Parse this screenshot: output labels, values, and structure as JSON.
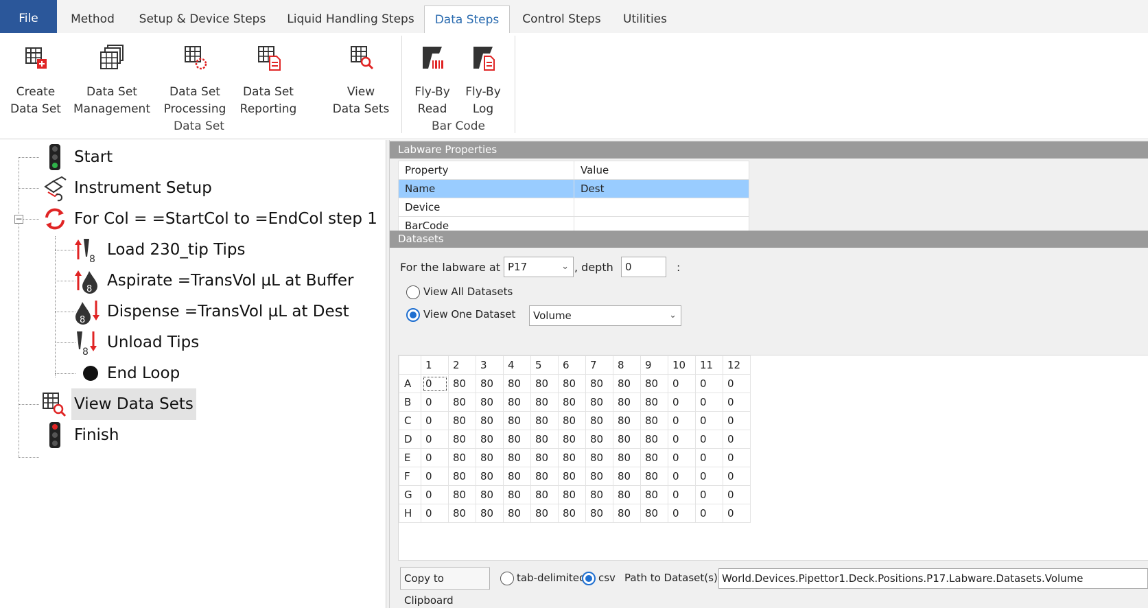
{
  "tabs": {
    "file": "File",
    "method": "Method",
    "setup": "Setup & Device Steps",
    "liquid": "Liquid Handling Steps",
    "data": "Data Steps",
    "control": "Control Steps",
    "utilities": "Utilities",
    "active": "Data Steps"
  },
  "ribbon": {
    "create_dataset": [
      "Create",
      "Data Set"
    ],
    "dataset_management": [
      "Data Set",
      "Management"
    ],
    "dataset_processing": [
      "Data Set",
      "Processing"
    ],
    "dataset_reporting": [
      "Data Set",
      "Reporting"
    ],
    "view_datasets": [
      "View",
      "Data Sets"
    ],
    "flyby_read": [
      "Fly-By",
      "Read"
    ],
    "flyby_log": [
      "Fly-By",
      "Log"
    ],
    "group_dataset": "Data Set",
    "group_barcode": "Bar Code"
  },
  "tree": {
    "start": "Start",
    "instrument_setup": "Instrument Setup",
    "for_col": "For Col = =StartCol to =EndCol step 1",
    "load_tips": "Load 230_tip Tips",
    "aspirate": "Aspirate =TransVol µL at Buffer",
    "dispense": "Dispense =TransVol µL at Dest",
    "unload_tips": "Unload Tips",
    "end_loop": "End Loop",
    "view_datasets": "View Data Sets",
    "finish": "Finish",
    "selected": "View Data Sets"
  },
  "labware_properties": {
    "header": "Labware Properties",
    "col_property": "Property",
    "col_value": "Value",
    "rows": [
      {
        "property": "Name",
        "value": "Dest"
      },
      {
        "property": "Device",
        "value": ""
      },
      {
        "property": "BarCode",
        "value": ""
      }
    ]
  },
  "datasets": {
    "header": "Datasets",
    "labware_label": "For the labware at",
    "labware_value": "P17",
    "depth_label": ", depth",
    "depth_value": "0",
    "colon": ":",
    "view_all_label": "View All Datasets",
    "view_one_label": "View One Dataset",
    "view_mode": "one",
    "dataset_value": "Volume",
    "columns": [
      "1",
      "2",
      "3",
      "4",
      "5",
      "6",
      "7",
      "8",
      "9",
      "10",
      "11",
      "12"
    ],
    "rows": [
      {
        "label": "A",
        "values": [
          "0",
          "80",
          "80",
          "80",
          "80",
          "80",
          "80",
          "80",
          "80",
          "0",
          "0",
          "0"
        ]
      },
      {
        "label": "B",
        "values": [
          "0",
          "80",
          "80",
          "80",
          "80",
          "80",
          "80",
          "80",
          "80",
          "0",
          "0",
          "0"
        ]
      },
      {
        "label": "C",
        "values": [
          "0",
          "80",
          "80",
          "80",
          "80",
          "80",
          "80",
          "80",
          "80",
          "0",
          "0",
          "0"
        ]
      },
      {
        "label": "D",
        "values": [
          "0",
          "80",
          "80",
          "80",
          "80",
          "80",
          "80",
          "80",
          "80",
          "0",
          "0",
          "0"
        ]
      },
      {
        "label": "E",
        "values": [
          "0",
          "80",
          "80",
          "80",
          "80",
          "80",
          "80",
          "80",
          "80",
          "0",
          "0",
          "0"
        ]
      },
      {
        "label": "F",
        "values": [
          "0",
          "80",
          "80",
          "80",
          "80",
          "80",
          "80",
          "80",
          "80",
          "0",
          "0",
          "0"
        ]
      },
      {
        "label": "G",
        "values": [
          "0",
          "80",
          "80",
          "80",
          "80",
          "80",
          "80",
          "80",
          "80",
          "0",
          "0",
          "0"
        ]
      },
      {
        "label": "H",
        "values": [
          "0",
          "80",
          "80",
          "80",
          "80",
          "80",
          "80",
          "80",
          "80",
          "0",
          "0",
          "0"
        ]
      }
    ],
    "copy_button": "Copy to Clipboard",
    "tab_delimited_label": "tab-delimited",
    "csv_label": "csv",
    "format": "csv",
    "path_label": "Path to Dataset(s):",
    "path_value": "World.Devices.Pipettor1.Deck.Positions.P17.Labware.Datasets.Volume"
  },
  "colors": {
    "file_tab": "#2b579a",
    "active_tab_text": "#2b6cb0",
    "selected_row": "#99ccff",
    "section_header": "#9a9a9a",
    "radio_accent": "#1f6fd0",
    "icon_red": "#e02424"
  }
}
